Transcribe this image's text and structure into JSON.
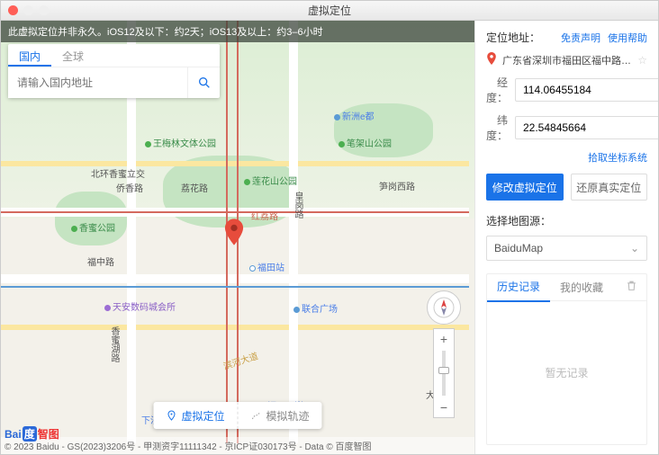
{
  "window": {
    "title": "虚拟定位"
  },
  "notice": "此虚拟定位并非永久。iOS12及以下：约2天；iOS13及以上：约3–6小时",
  "search": {
    "tabs": {
      "domestic": "国内",
      "global": "全球"
    },
    "placeholder": "请输入国内地址"
  },
  "map_labels": {
    "wumeilin": "王梅林文体公园",
    "beihuan": "北环香蜜立交",
    "qiaoxiang": "侨香路",
    "lianhua": "莲花山公园",
    "lihua": "荔花路",
    "huanggang": "皇岗路",
    "hongli": "红荔路",
    "bijiashan": "笔架山公园",
    "sungang": "笋岗西路",
    "xinzhou": "新洲e都",
    "xiangmi": "香蜜公园",
    "fuzhong": "福中路",
    "futian_station": "福田站",
    "tianan": "天安数码城会所",
    "lianhe": "联合广场",
    "binhe": "滨河大道",
    "xiangmihu": "香蜜湖路",
    "xiasha": "下沙",
    "dashipan": "大石盘",
    "futian_koan": "福田口岸"
  },
  "bottom_toolbar": {
    "virtual": "虚拟定位",
    "track": "模拟轨迹"
  },
  "map_attrib": "© 2023 Baidu - GS(2023)3206号 - 甲测资字11111342 - 京ICP证030173号 - Data © 百度智图",
  "baidu_logo": {
    "a": "Bai",
    "b": "度",
    "c": "智图"
  },
  "side": {
    "header": "定位地址：",
    "links": {
      "disclaimer": "免责声明",
      "help": "使用帮助"
    },
    "address": "广东省深圳市福田区福中路华富…",
    "longitude_label": "经度：",
    "longitude_value": "114.06455184",
    "latitude_label": "纬度：",
    "latitude_value": "22.54845664",
    "get_coords": "拾取坐标系统",
    "btn_modify": "修改虚拟定位",
    "btn_restore": "还原真实定位",
    "map_source_label": "选择地图源：",
    "map_source_value": "BaiduMap",
    "hist_tabs": {
      "history": "历史记录",
      "fav": "我的收藏"
    },
    "hist_empty": "暂无记录"
  }
}
